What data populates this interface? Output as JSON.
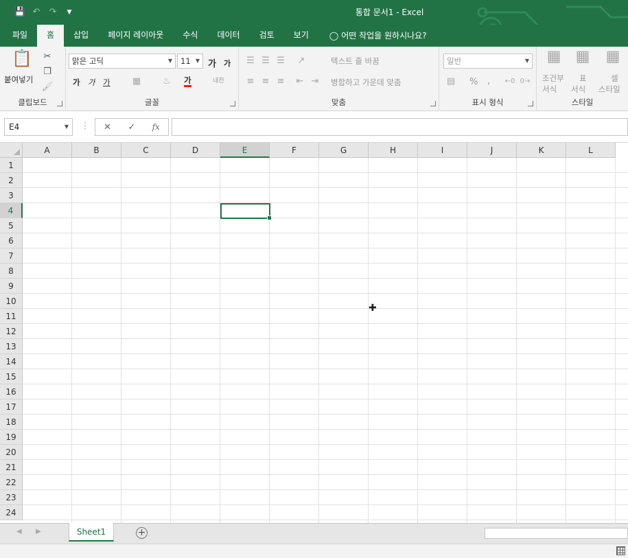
{
  "titlebar": {
    "title": "통합 문서1  -  Excel",
    "icons": [
      "save-icon",
      "undo-icon",
      "redo-icon",
      "customize-qat-icon"
    ]
  },
  "tabs": [
    {
      "label": "파일"
    },
    {
      "label": "홈"
    },
    {
      "label": "삽입"
    },
    {
      "label": "페이지 레이아웃"
    },
    {
      "label": "수식"
    },
    {
      "label": "데이터"
    },
    {
      "label": "검토"
    },
    {
      "label": "보기"
    }
  ],
  "tellme": "어떤 작업을 원하시나요?",
  "ribbon": {
    "clipboard": {
      "paste": "붙여넣기",
      "label": "클립보드"
    },
    "font": {
      "name": "맑은 고딕",
      "size": "11",
      "grow": "가",
      "shrink": "가",
      "bold": "가",
      "italic": "가",
      "underline": "가",
      "color_glyph": "가",
      "phonetic": "내천",
      "label": "글꼴"
    },
    "alignment": {
      "wrap": "텍스트 줄 바꿈",
      "merge": "병합하고 가운데 맞춤",
      "label": "맞춤"
    },
    "number": {
      "format": "일반",
      "percent": "%",
      "comma": ",",
      "label": "표시 형식"
    },
    "styles": {
      "conditional_1": "조건부",
      "conditional_2": "서식",
      "table_1": "표",
      "table_2": "서식",
      "cell_1": "셀",
      "cell_2": "스타일",
      "label": "스타일"
    }
  },
  "formula_bar": {
    "name_box": "E4",
    "cancel": "✕",
    "enter": "✓",
    "fx": "fx"
  },
  "grid": {
    "columns": [
      "A",
      "B",
      "C",
      "D",
      "E",
      "F",
      "G",
      "H",
      "I",
      "J",
      "K",
      "L"
    ],
    "rows": [
      "1",
      "2",
      "3",
      "4",
      "5",
      "6",
      "7",
      "8",
      "9",
      "10",
      "11",
      "12",
      "13",
      "14",
      "15",
      "16",
      "17",
      "18",
      "19",
      "20",
      "21",
      "22",
      "23",
      "24"
    ],
    "selected_column": "E",
    "selected_row": "4"
  },
  "sheets": {
    "tabs": [
      "Sheet1"
    ],
    "add": "+"
  },
  "colors": {
    "accent": "#217346",
    "ribbon_bg": "#f3f3f3",
    "header_bg": "#e6e6e6"
  }
}
